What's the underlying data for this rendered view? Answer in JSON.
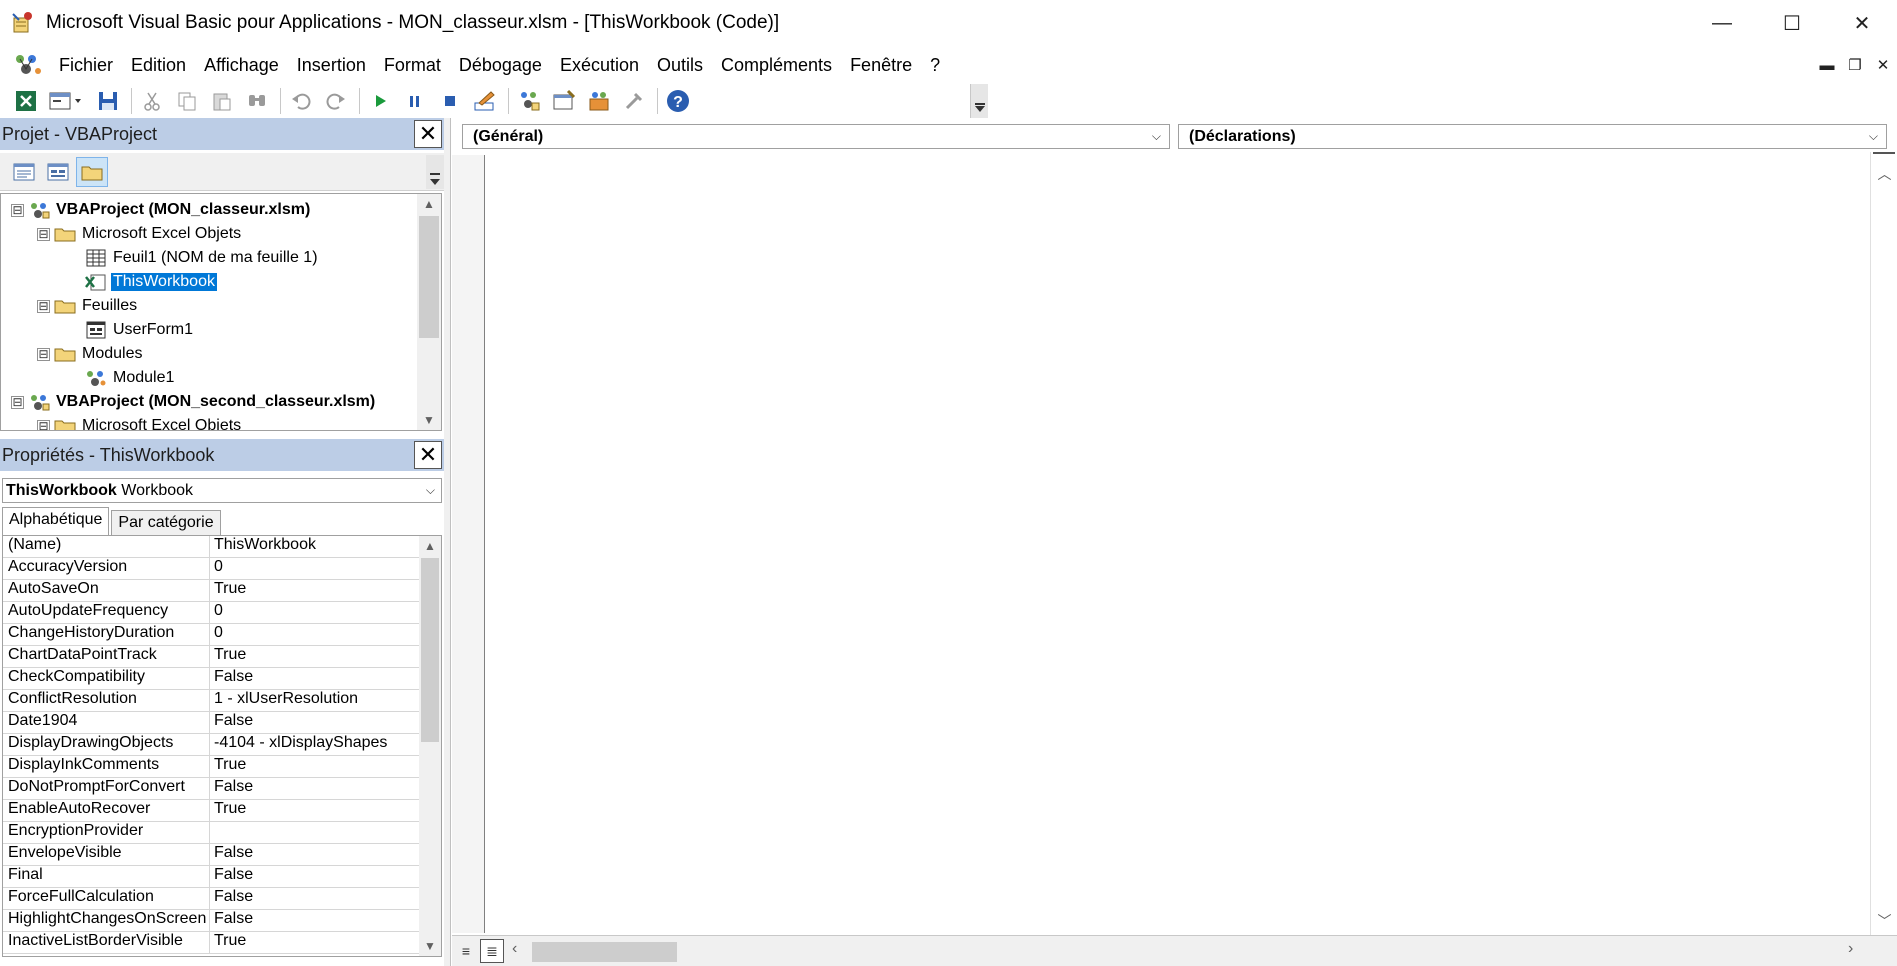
{
  "window": {
    "title": "Microsoft Visual Basic pour Applications - MON_classeur.xlsm - [ThisWorkbook (Code)]",
    "controls": {
      "minimize": "—",
      "maximize": "☐",
      "close": "✕"
    }
  },
  "menu": {
    "items": [
      "Fichier",
      "Edition",
      "Affichage",
      "Insertion",
      "Format",
      "Débogage",
      "Exécution",
      "Outils",
      "Compléments",
      "Fenêtre",
      "?"
    ],
    "mdi_controls": {
      "minimize": "▬",
      "restore": "❐",
      "close": "✕"
    }
  },
  "toolbar": {
    "buttons": [
      "view-excel",
      "insert-userform",
      "save",
      "cut",
      "copy",
      "paste",
      "find",
      "undo",
      "redo",
      "run",
      "break",
      "reset",
      "design-mode",
      "project-explorer",
      "properties-window",
      "object-browser",
      "toolbox",
      "help"
    ]
  },
  "project_panel": {
    "title": "Projet - VBAProject",
    "close_label": "✕",
    "tree": [
      {
        "label": "VBAProject (MON_classeur.xlsm)",
        "level": 0,
        "icon": "vbaproject-icon",
        "expander": "⊟",
        "bold": true
      },
      {
        "label": "Microsoft Excel Objets",
        "level": 1,
        "icon": "folder-icon",
        "expander": "⊟"
      },
      {
        "label": "Feuil1 (NOM de ma feuille 1)",
        "level": 2,
        "icon": "worksheet-icon"
      },
      {
        "label": "ThisWorkbook",
        "level": 2,
        "icon": "workbook-icon",
        "selected": true
      },
      {
        "label": "Feuilles",
        "level": 1,
        "icon": "folder-icon",
        "expander": "⊟"
      },
      {
        "label": "UserForm1",
        "level": 2,
        "icon": "userform-icon"
      },
      {
        "label": "Modules",
        "level": 1,
        "icon": "folder-icon",
        "expander": "⊟"
      },
      {
        "label": "Module1",
        "level": 2,
        "icon": "module-icon"
      },
      {
        "label": "VBAProject (MON_second_classeur.xlsm)",
        "level": 0,
        "icon": "vbaproject-icon",
        "expander": "⊟",
        "bold": true
      },
      {
        "label": "Microsoft Excel Objets",
        "level": 1,
        "icon": "folder-icon",
        "expander": "⊟"
      }
    ]
  },
  "properties_panel": {
    "title": "Propriétés - ThisWorkbook",
    "close_label": "✕",
    "object_name": "ThisWorkbook",
    "object_type": "Workbook",
    "tabs": [
      "Alphabétique",
      "Par catégorie"
    ],
    "rows": [
      {
        "name": "(Name)",
        "value": "ThisWorkbook"
      },
      {
        "name": "AccuracyVersion",
        "value": "0"
      },
      {
        "name": "AutoSaveOn",
        "value": "True"
      },
      {
        "name": "AutoUpdateFrequency",
        "value": "0"
      },
      {
        "name": "ChangeHistoryDuration",
        "value": "0"
      },
      {
        "name": "ChartDataPointTrack",
        "value": "True"
      },
      {
        "name": "CheckCompatibility",
        "value": "False"
      },
      {
        "name": "ConflictResolution",
        "value": "1 - xlUserResolution"
      },
      {
        "name": "Date1904",
        "value": "False"
      },
      {
        "name": "DisplayDrawingObjects",
        "value": "-4104 - xlDisplayShapes"
      },
      {
        "name": "DisplayInkComments",
        "value": "True"
      },
      {
        "name": "DoNotPromptForConvert",
        "value": "False"
      },
      {
        "name": "EnableAutoRecover",
        "value": "True"
      },
      {
        "name": "EncryptionProvider",
        "value": ""
      },
      {
        "name": "EnvelopeVisible",
        "value": "False"
      },
      {
        "name": "Final",
        "value": "False"
      },
      {
        "name": "ForceFullCalculation",
        "value": "False"
      },
      {
        "name": "HighlightChangesOnScreen",
        "value": "False"
      },
      {
        "name": "InactiveListBorderVisible",
        "value": "True"
      }
    ]
  },
  "code_window": {
    "object_select": "(Général)",
    "procedure_select": "(Déclarations)",
    "caret": "⌵"
  },
  "colors": {
    "panel_header": "#bccde6",
    "selection": "#0078d7",
    "run_green": "#1a9a3c",
    "break_blue": "#2a5db0"
  }
}
